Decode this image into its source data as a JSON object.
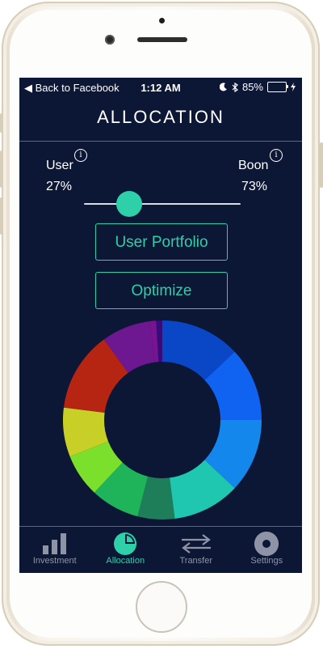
{
  "status_bar": {
    "back_label": "◀ Back to Facebook",
    "time": "1:12 AM",
    "battery_percent": "85%",
    "battery_level": 0.85
  },
  "header": {
    "title": "ALLOCATION"
  },
  "allocation": {
    "user_label": "User",
    "user_pct": "27%",
    "boon_label": "Boon",
    "boon_pct": "73%",
    "slider_value": 0.27,
    "info_glyph": "i"
  },
  "buttons": {
    "user_portfolio": "User Portfolio",
    "optimize": "Optimize"
  },
  "chart_data": {
    "type": "pie",
    "donut": true,
    "slices": [
      {
        "color": "#0a47c6",
        "value": 13
      },
      {
        "color": "#1062f0",
        "value": 12
      },
      {
        "color": "#1487ec",
        "value": 12
      },
      {
        "color": "#1fc6b0",
        "value": 11
      },
      {
        "color": "#1e7e5a",
        "value": 6
      },
      {
        "color": "#1fb35a",
        "value": 8
      },
      {
        "color": "#7be02c",
        "value": 7
      },
      {
        "color": "#c8cf26",
        "value": 8
      },
      {
        "color": "#b62412",
        "value": 13
      },
      {
        "color": "#6d1790",
        "value": 8
      },
      {
        "color": "#7a1391",
        "value": 1
      },
      {
        "color": "#360b7a",
        "value": 1
      }
    ]
  },
  "tabs": [
    {
      "label": "Investment",
      "icon": "bar-chart-icon",
      "active": false
    },
    {
      "label": "Allocation",
      "icon": "pie-chart-icon",
      "active": true
    },
    {
      "label": "Transfer",
      "icon": "transfer-arrows-icon",
      "active": false
    },
    {
      "label": "Settings",
      "icon": "gear-icon",
      "active": false
    }
  ],
  "colors": {
    "accent": "#2ed0a9",
    "background": "#0c1635",
    "inactive": "#8e94a6"
  }
}
